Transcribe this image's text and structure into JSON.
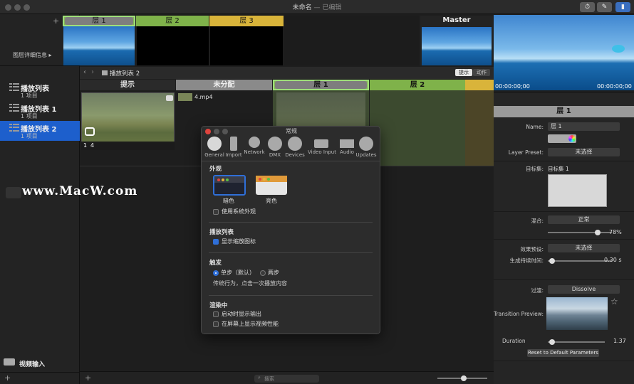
{
  "window": {
    "title": "未命名",
    "subtitle": "— 已编辑"
  },
  "toolbar": {
    "timer_icon": "timer-icon",
    "edit_icon": "pencil-icon",
    "panel_icon": "panel-icon"
  },
  "sidebar": {
    "layer_info_label": "图层详细信息",
    "add_label": "+",
    "items": [
      {
        "name": "播放列表",
        "count": "1 项目"
      },
      {
        "name": "播放列表 1",
        "count": "1 项目"
      },
      {
        "name": "播放列表 2",
        "count": "1 项目"
      }
    ],
    "video_input_label": "视频输入",
    "bottom_add": "+"
  },
  "layers": {
    "add_label": "+",
    "tabs": [
      {
        "label": "层 1",
        "color": "#7fb24a"
      },
      {
        "label": "层 2",
        "color": "#7fb24a"
      },
      {
        "label": "层 3",
        "color": "#d9b43a"
      }
    ],
    "master_label": "Master"
  },
  "cuebar": {
    "breadcrumb": "播放列表 2",
    "toggle_cue": "提示",
    "toggle_action": "动作",
    "headers": [
      "提示",
      "未分配",
      "层 1",
      "层 2"
    ],
    "clip_name": "4.mp4",
    "clip_index": "1",
    "clip_number": "4"
  },
  "preview": {
    "time_left": "00:00:00;00",
    "time_right": "00:00:00;00"
  },
  "watermark": "www.MacW.com",
  "dialog": {
    "title": "常规",
    "tabs": [
      "General",
      "Import",
      "Network",
      "DMX",
      "Devices",
      "Video Input",
      "Audio",
      "Updates"
    ],
    "appearance": {
      "heading": "外观",
      "dark": "暗色",
      "light": "亮色",
      "use_system": "使用系统外观"
    },
    "playlist": {
      "heading": "播放列表",
      "show_thumb": "显示缩放图标"
    },
    "trigger": {
      "heading": "触发",
      "single": "单步（默认）",
      "double": "两步",
      "desc": "传统行为，点击一次播放内容"
    },
    "render": {
      "heading": "渲染中",
      "show_output": "启动时显示输出",
      "show_perf": "在屏幕上显示视频性能"
    }
  },
  "inspector": {
    "title": "层 1",
    "name_label": "Name:",
    "name_value": "层 1",
    "preset_label": "Layer Preset:",
    "preset_value": "未选择",
    "target_label": "目标集:",
    "target_value": "目标集 1",
    "blend_label": "混合:",
    "blend_value": "正常",
    "opacity_value": "78%",
    "opacity": 0.78,
    "effect_label": "效果预设:",
    "effect_value": "未选择",
    "fade_label": "生成持续时间:",
    "fade_value": "0.30 s",
    "transition_label": "过渡:",
    "transition_value": "Dissolve",
    "transition_preview_label": "Transition Preview:",
    "duration_label": "Duration",
    "duration_value": "1.37",
    "reset_label": "Reset to Default Parameters"
  },
  "footer": {
    "search_placeholder": "搜索",
    "add": "+"
  }
}
